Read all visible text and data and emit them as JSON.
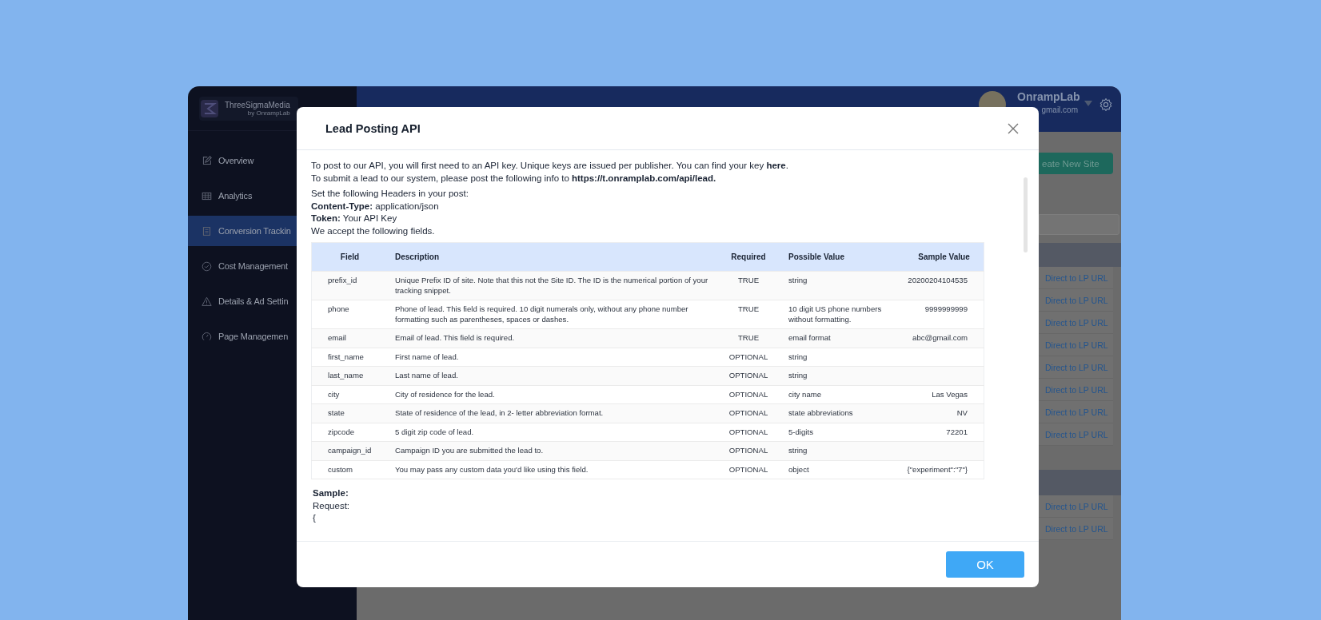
{
  "sidebar": {
    "brand": {
      "name": "ThreeSigmaMedia",
      "tagline": "by OnrampLab"
    },
    "items": [
      {
        "label": "Overview",
        "selected": false
      },
      {
        "label": "Analytics",
        "selected": false
      },
      {
        "label": "Conversion Trackin",
        "selected": true
      },
      {
        "label": "Cost Management",
        "selected": false
      },
      {
        "label": "Details & Ad Settin",
        "selected": false
      },
      {
        "label": "Page Managemen",
        "selected": false
      }
    ]
  },
  "header": {
    "user_name": "OnrampLab",
    "user_email": "gmail.com"
  },
  "background": {
    "create_button": "eate New Site",
    "table_groups": [
      {
        "links": [
          "Direct to LP URL",
          "Direct to LP URL",
          "Direct to LP URL",
          "Direct to LP URL",
          "Direct to LP URL",
          "Direct to LP URL",
          "Direct to LP URL",
          "Direct to LP URL"
        ]
      },
      {
        "links": [
          "Direct to LP URL",
          "Direct to LP URL"
        ]
      }
    ]
  },
  "modal": {
    "title": "Lead Posting API",
    "intro": [
      "To post to our API, you will first need to an API key. Unique keys are issued per publisher. You can find your key **here**.",
      "To submit a lead to our system, please post the following info to **https://t.onramplab.com/api/lead.**"
    ],
    "headers_intro": [
      "Set the following Headers in your post:",
      "**Content-Type:** application/json",
      "**Token:** Your API Key",
      "We accept the following fields."
    ],
    "table": {
      "columns": [
        "Field",
        "Description",
        "Required",
        "Possible Value",
        "Sample Value"
      ],
      "rows": [
        [
          "prefix_id",
          "Unique Prefix ID of site. Note that this not the Site ID. The ID is the numerical portion of your tracking snippet.",
          "TRUE",
          "string",
          "20200204104535"
        ],
        [
          "phone",
          "Phone of lead. This field is required. 10 digit numerals only, without any phone number formatting such as parentheses, spaces or dashes.",
          "TRUE",
          "10 digit US phone numbers without formatting.",
          "9999999999"
        ],
        [
          "email",
          "Email of lead. This field is required.",
          "TRUE",
          "email format",
          "abc@gmail.com"
        ],
        [
          "first_name",
          "First name of lead.",
          "OPTIONAL",
          "string",
          ""
        ],
        [
          "last_name",
          "Last name of lead.",
          "OPTIONAL",
          "string",
          ""
        ],
        [
          "city",
          "City of residence for the lead.",
          "OPTIONAL",
          "city name",
          "Las Vegas"
        ],
        [
          "state",
          "State of residence of the lead, in 2- letter abbreviation format.",
          "OPTIONAL",
          "state abbreviations",
          "NV"
        ],
        [
          "zipcode",
          "5 digit zip code of lead.",
          "OPTIONAL",
          "5-digits",
          "72201"
        ],
        [
          "campaign_id",
          "Campaign ID you are submitted the lead to.",
          "OPTIONAL",
          "string",
          ""
        ],
        [
          "custom",
          "You may pass any custom data you'd like using this field.",
          "OPTIONAL",
          "object",
          "{\"experiment\":\"7\"}"
        ]
      ]
    },
    "sample_heading": "Sample:",
    "sample_lines": [
      "Request:",
      "{"
    ],
    "ok_button": "OK"
  }
}
